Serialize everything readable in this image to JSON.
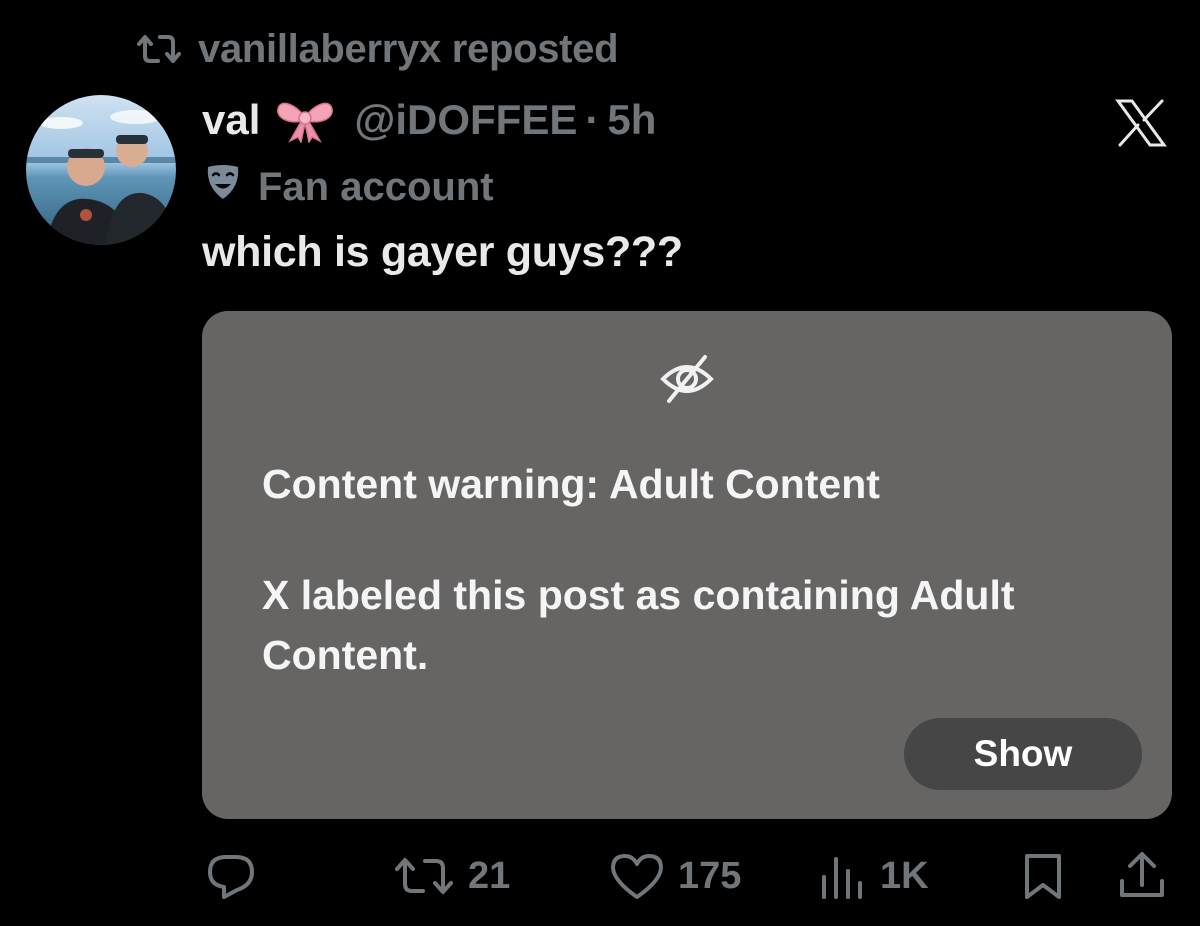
{
  "repost": {
    "icon": "repost-icon",
    "text": "vanillaberryx reposted"
  },
  "post": {
    "display_name": "val",
    "name_emoji": "ribbon-bow-emoji",
    "handle": "@iDOFFEE",
    "separator": "·",
    "time": "5h",
    "label_icon": "theater-mask-icon",
    "label": "Fan account",
    "text": "which is gayer guys???"
  },
  "media": {
    "icon": "eye-slash-icon",
    "warning_title": "Content warning: Adult Content",
    "warning_body": "X labeled this post as containing Adult Content.",
    "show_label": "Show"
  },
  "actions": {
    "reply": {
      "icon": "reply-icon",
      "count": ""
    },
    "repost": {
      "icon": "repost-icon",
      "count": "21"
    },
    "like": {
      "icon": "heart-icon",
      "count": "175"
    },
    "views": {
      "icon": "views-icon",
      "count": "1K"
    },
    "bookmark": {
      "icon": "bookmark-icon"
    },
    "share": {
      "icon": "share-icon"
    }
  },
  "brand": {
    "logo": "x-logo",
    "background": "#000000",
    "muted_text": "#71767b",
    "primary_text": "#e7e9ea",
    "card_background": "#676464",
    "button_background": "#464646"
  }
}
